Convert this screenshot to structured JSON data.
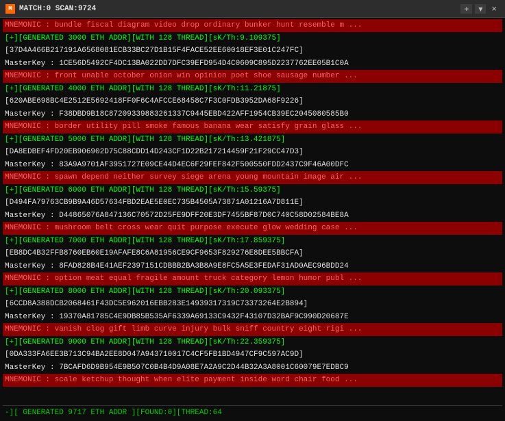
{
  "titleBar": {
    "appIcon": "M",
    "title": "MATCH:0 SCAN:9724",
    "closeLabel": "×",
    "addTabLabel": "+",
    "arrowLabel": "▾"
  },
  "entries": [
    {
      "mnemonic": "MNEMONIC : bundle fiscal diagram video drop ordinary bunker hunt resemble m ...",
      "generated": "[+][GENERATED 3000 ETH ADDR][WITH 128 THREAD][sK/Th:9.109375]",
      "addr": "[37D4A466B217191A6568081ECB33BC27D1B15F4FACE52EE60018EF3E01C247FC]",
      "masterkey": "MasterKey :  1CE56D5492CF4DC13BA022DD7DFC39EFD954D4C0609C895D2237762EE05B1C0A"
    },
    {
      "mnemonic": "MNEMONIC : front unable october onion win opinion poet shoe sausage number ...",
      "generated": "[+][GENERATED 4000 ETH ADDR][WITH 128 THREAD][sK/Th:11.21875]",
      "addr": "[620ABE698BC4E2512E5692418FF0F6C4AFCCE68458C7F3C0FDB3952DA68F9226]",
      "masterkey": "MasterKey :  F38DBD9B18C87209339883261337C9445EBD422AFF1954CB39EC2045080585B0"
    },
    {
      "mnemonic": "MNEMONIC : border utility pill smoke famous banana wear satisfy grain glass ...",
      "generated": "[+][GENERATED 5000 ETH ADDR][WITH 128 THREAD][sK/Th:13.421875]",
      "addr": "[DA8EDBEF4FD20EB906902D75C88CDD14D243CF1D22B217214459F21F29CC47D3]",
      "masterkey": "MasterKey :  83A9A9701AF3951727E09CE44D4EC6F29FEF842F500550FDD2437C9F46A00DFC"
    },
    {
      "mnemonic": "MNEMONIC : spawn depend neither survey siege arena young mountain image air ...",
      "generated": "[+][GENERATED 6000 ETH ADDR][WITH 128 THREAD][sK/Th:15.59375]",
      "addr": "[D494FA79763CB9B9A46D57634FBD2EAE5E0EC735B4505A73871A01216A7D811E]",
      "masterkey": "MasterKey :  D44865076A847136C70572D25FE9DFF20E3DF7455BF87D0C740C58D02584BE8A"
    },
    {
      "mnemonic": "MNEMONIC : mushroom belt cross wear quit purpose execute glow wedding case ...",
      "generated": "[+][GENERATED 7000 ETH ADDR][WITH 128 THREAD][sK/Th:17.859375]",
      "addr": "[EB8DC4B32FFB8760EB60E19AFAFE8C6A81956CE9CF9653F829276E8DEE5BBCFA]",
      "masterkey": "MasterKey :  8FAD828B4E41AEF2397151CDBBB2BA3B8A9E8FC5A5E3FEDAF31AD0AEC96BDD24"
    },
    {
      "mnemonic": "MNEMONIC : option meat equal fragile amount truck category lemon humor publ ...",
      "generated": "[+][GENERATED 8000 ETH ADDR][WITH 128 THREAD][sK/Th:20.093375]",
      "addr": "[6CCD8A388DCB2068461F43DC5E962016EBB283E14939317319C73373264E2B894]",
      "masterkey": "MasterKey :  19370A81785C4E9DB85B535AF6339A69133C9432F43107D32BAF9C990D20687E"
    },
    {
      "mnemonic": "MNEMONIC : vanish clog gift limb curve injury bulk sniff country eight rigi ...",
      "generated": "[+][GENERATED 9000 ETH ADDR][WITH 128 THREAD][sK/Th:22.359375]",
      "addr": "[0DA333FA6EE3B713C94BA2EE8D047A943710017C4CF5FB1BD4947CF9C597AC9D]",
      "masterkey": "MasterKey :  7BCAFD6D9B954E9B507C0B4B4D9A08E7A2A9C2D44B32A3A8001C60079E7EDBC9"
    },
    {
      "mnemonic": "MNEMONIC : scale ketchup thought when elite payment inside word chair food ...",
      "generated": "",
      "addr": "",
      "masterkey": ""
    }
  ],
  "statusLine": "-][ GENERATED 9717 ETH ADDR ][FOUND:0][THREAD:64"
}
